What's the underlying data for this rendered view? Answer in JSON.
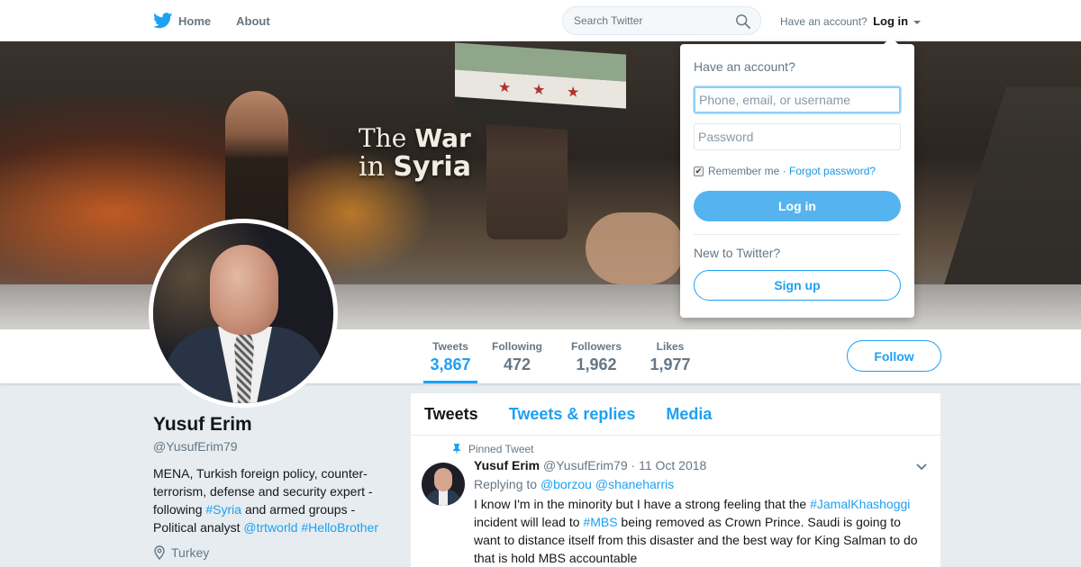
{
  "nav": {
    "home_label": "Home",
    "about_label": "About",
    "search_placeholder": "Search Twitter",
    "have_account": "Have an account?",
    "login_label": "Log in"
  },
  "banner": {
    "title_line1_a": "The ",
    "title_line1_b": "War",
    "title_line2_a": "in ",
    "title_line2_b": "Syria"
  },
  "stats": [
    {
      "label": "Tweets",
      "value": "3,867"
    },
    {
      "label": "Following",
      "value": "472"
    },
    {
      "label": "Followers",
      "value": "1,962"
    },
    {
      "label": "Likes",
      "value": "1,977"
    }
  ],
  "follow_label": "Follow",
  "profile": {
    "name": "Yusuf Erim",
    "handle": "@YusufErim79",
    "bio_1": "MENA, Turkish foreign policy, counter-terrorism, defense and security expert - following ",
    "bio_tag_syria": "#Syria",
    "bio_2": " and armed groups - Political analyst ",
    "bio_mention": "@trtworld",
    "bio_3": " ",
    "bio_tag_brother": "#HelloBrother",
    "location": "Turkey"
  },
  "tabs": [
    "Tweets",
    "Tweets & replies",
    "Media"
  ],
  "tweet": {
    "pinned_label": "Pinned Tweet",
    "name": "Yusuf Erim",
    "handle": "@YusufErim79",
    "dot": "·",
    "date": "11 Oct 2018",
    "replying_to": "Replying to",
    "reply_1": "@borzou",
    "reply_2": "@shaneharris",
    "text_1": "I know I'm in the minority but I have a strong feeling that the ",
    "tag_1": "#JamalKhashoggi",
    "text_2": " incident will lead to ",
    "tag_2": "#MBS",
    "text_3": " being removed as Crown Prince. Saudi is going to want to distance itself from this disaster and the best way for King Salman to do that is hold MBS accountable"
  },
  "login": {
    "question": "Have an account?",
    "username_placeholder": "Phone, email, or username",
    "password_placeholder": "Password",
    "remember": "Remember me",
    "sep": " · ",
    "forgot": "Forgot password?",
    "login_button": "Log in",
    "new_question": "New to Twitter?",
    "signup_button": "Sign up"
  },
  "colors": {
    "accent": "#1da1f2",
    "login_button": "#55b4ef",
    "background": "#e6ecf0"
  },
  "icons": [
    "twitter-bird-icon",
    "search-icon",
    "caret-down-icon",
    "pin-icon",
    "location-icon",
    "chevron-down-icon",
    "checkbox-checked-icon"
  ]
}
